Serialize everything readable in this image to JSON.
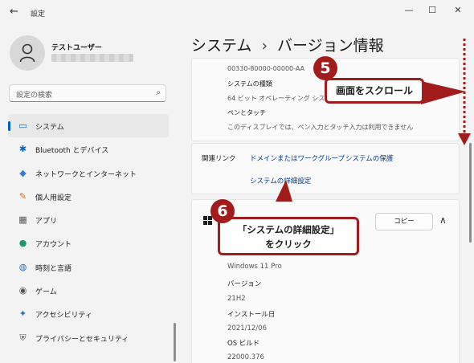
{
  "window": {
    "title": "設定",
    "back_glyph": "←",
    "min_glyph": "—",
    "max_glyph": "☐",
    "close_glyph": "✕"
  },
  "user": {
    "name": "テストユーザー"
  },
  "search": {
    "placeholder": "設定の検索",
    "icon": "⌕"
  },
  "nav": [
    {
      "label": "システム",
      "icon": "system-icon",
      "glyph": "▭",
      "color": "#0067c0",
      "active": true
    },
    {
      "label": "Bluetooth とデバイス",
      "icon": "bluetooth-icon",
      "glyph": "✱",
      "color": "#0067c0"
    },
    {
      "label": "ネットワークとインターネット",
      "icon": "network-icon",
      "glyph": "◆",
      "color": "#2a7fd4"
    },
    {
      "label": "個人用設定",
      "icon": "personalization-icon",
      "glyph": "✎",
      "color": "#d66b1a"
    },
    {
      "label": "アプリ",
      "icon": "apps-icon",
      "glyph": "▦",
      "color": "#555555"
    },
    {
      "label": "アカウント",
      "icon": "account-icon",
      "glyph": "●",
      "color": "#1a9a6c"
    },
    {
      "label": "時刻と言語",
      "icon": "time-language-icon",
      "glyph": "◍",
      "color": "#1f6fc2"
    },
    {
      "label": "ゲーム",
      "icon": "gaming-icon",
      "glyph": "◉",
      "color": "#555555"
    },
    {
      "label": "アクセシビリティ",
      "icon": "accessibility-icon",
      "glyph": "✦",
      "color": "#1f6fc2"
    },
    {
      "label": "プライバシーとセキュリティ",
      "icon": "privacy-security-icon",
      "glyph": "⛨",
      "color": "#555555"
    }
  ],
  "header": {
    "section": "システム",
    "separator": "›",
    "page": "バージョン情報"
  },
  "device_specs": {
    "product_id_value": "00330-80000-00000-AA",
    "system_type_label": "システムの種類",
    "system_type_value": "64 ビット オペレーティング システ",
    "pen_touch_label": "ペンとタッチ",
    "pen_touch_value": "このディスプレイでは、ペン入力とタッチ入力は利用できません"
  },
  "related": {
    "title": "関連リンク",
    "links": [
      "ドメインまたはワークグループ",
      "システムの保護",
      "システムの詳細設定"
    ]
  },
  "windows_spec": {
    "copy_label": "コピー",
    "collapse_glyph": "∧",
    "edition_value": "Windows 11 Pro",
    "version_label": "バージョン",
    "version_value": "21H2",
    "install_label": "インストール日",
    "install_value": "2021/12/06",
    "build_label": "OS ビルド",
    "build_value": "22000.376"
  },
  "annotations": {
    "step5_number": "5",
    "step5_text": "画面をスクロール",
    "step6_number": "6",
    "step6_line1": "「システムの詳細設定」",
    "step6_line2": "をクリック",
    "color": "#a31c1c"
  }
}
